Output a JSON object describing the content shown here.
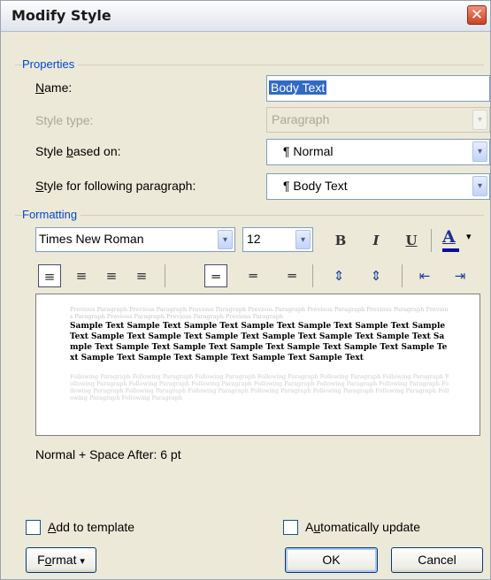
{
  "window": {
    "title": "Modify Style",
    "close_glyph": "✕"
  },
  "properties": {
    "group_title": "Properties",
    "name_label_u": "N",
    "name_label_rest": "ame:",
    "name_value": "Body Text",
    "style_type_label": "Style type:",
    "style_type_value": "Paragraph",
    "based_on_label_pre": "Style ",
    "based_on_label_u": "b",
    "based_on_label_rest": "ased on:",
    "based_on_value": "¶ Normal",
    "following_label_u": "S",
    "following_label_rest": "tyle for following paragraph:",
    "following_value": "¶ Body Text"
  },
  "formatting": {
    "group_title": "Formatting",
    "font_name": "Times New Roman",
    "font_size": "12",
    "bold_glyph": "B",
    "italic_glyph": "I",
    "underline_glyph": "U",
    "font_color_glyph": "A",
    "font_color_arrow": "▾",
    "font_color_bar": "#0b0b9c",
    "dropdown_arrow": "▾",
    "preview_previous": "Previous Paragraph Previous Paragraph Previous Paragraph Previous Paragraph Previous Paragraph Previous Paragraph Previous Paragraph Previous Paragraph Previous Paragraph Previous Paragraph",
    "preview_sample": "Sample Text Sample Text Sample Text Sample Text Sample Text Sample Text Sample Text Sample Text Sample Text Sample Text Sample Text Sample Text Sample Text Sample Text Sample Text Sample Text Sample Text Sample Text Sample Text Sample Text Sample Text Sample Text Sample Text Sample Text Sample Text",
    "preview_following": "Following Paragraph Following Paragraph Following Paragraph Following Paragraph Following Paragraph Following Paragraph Following Paragraph Following Paragraph Following Paragraph Following Paragraph Following Paragraph Following Paragraph Following Paragraph Following Paragraph Following Paragraph Following Paragraph Following Paragraph Following Paragraph Following Paragraph Following Paragraph",
    "description": "Normal + Space After:  6 pt",
    "icons": {
      "align_left": "≡",
      "align_center": "≡",
      "align_right": "≡",
      "justify": "≡",
      "single_spacing": "═",
      "one_half_spacing": "═",
      "double_spacing": "═",
      "increase_para_spacing": "⇕",
      "decrease_para_spacing": "⇕",
      "decrease_indent": "⇤",
      "increase_indent": "⇥"
    }
  },
  "footer": {
    "add_template_u": "A",
    "add_template_rest": "dd to template",
    "auto_update_pre": "A",
    "auto_update_u": "u",
    "auto_update_rest": "tomatically update",
    "format_u": "o",
    "format_pre": "F",
    "format_rest": "rmat",
    "format_arrow": "▾",
    "ok_label": "OK",
    "cancel_label": "Cancel"
  }
}
